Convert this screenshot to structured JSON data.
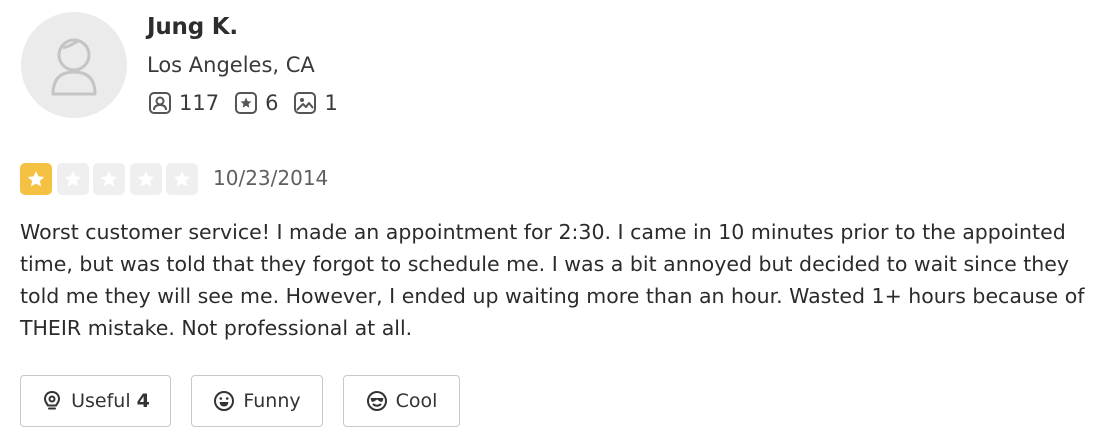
{
  "user": {
    "name": "Jung K.",
    "location": "Los Angeles, CA",
    "stats": {
      "friends": "117",
      "reviews": "6",
      "photos": "1"
    }
  },
  "review": {
    "rating": 1,
    "rating_max": 5,
    "date": "10/23/2014",
    "text": "Worst customer service!  I made an appointment for 2:30.  I came in 10 minutes prior to the appointed time, but was told that they forgot to schedule me.  I was a bit annoyed but decided to wait since they told me they will see me.  However, I ended up waiting more than an hour.  Wasted 1+ hours because of THEIR mistake.  Not professional at all."
  },
  "reactions": {
    "useful": {
      "label": "Useful",
      "count": "4",
      "icon": "lightbulb-icon"
    },
    "funny": {
      "label": "Funny",
      "icon": "laugh-face-icon"
    },
    "cool": {
      "label": "Cool",
      "icon": "sunglasses-face-icon"
    }
  },
  "colors": {
    "star_filled": "#f5c143",
    "star_empty": "#efefef",
    "text": "#2b2b2b",
    "border": "#c8c8c8"
  }
}
